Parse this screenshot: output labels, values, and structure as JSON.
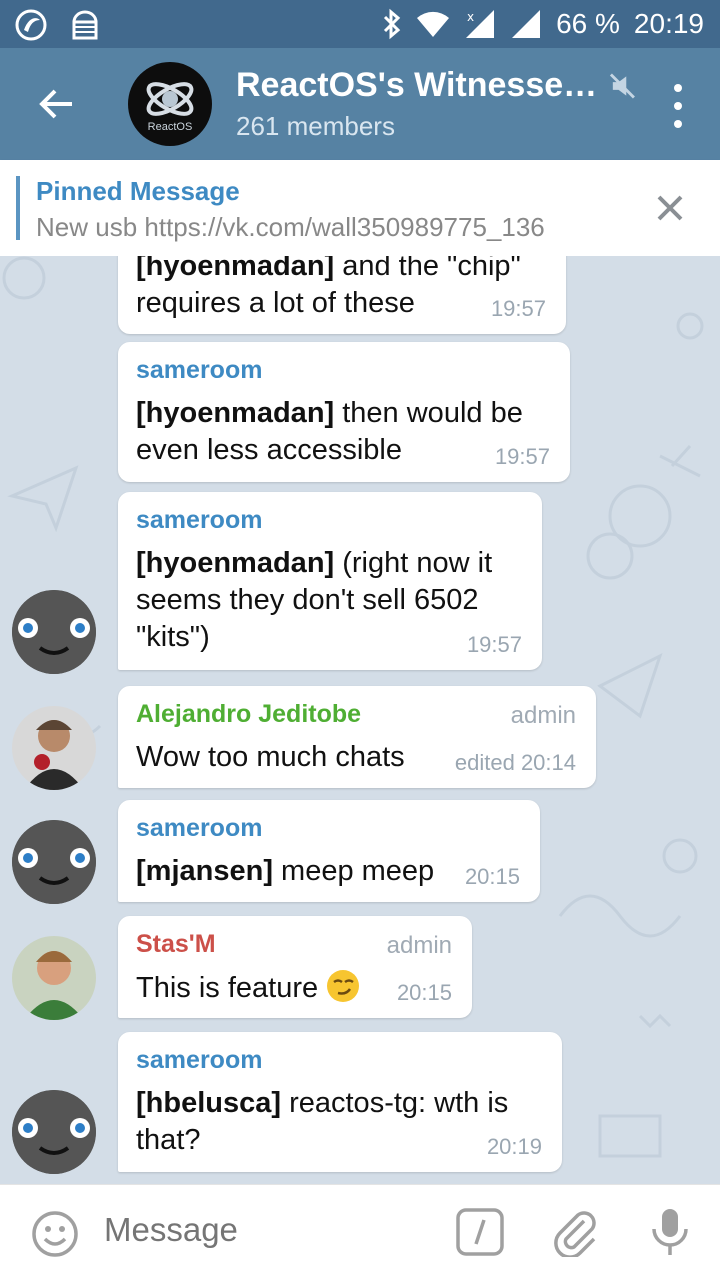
{
  "status_bar": {
    "battery": "66 %",
    "time": "20:19"
  },
  "header": {
    "title": "ReactOS's Witnesse…",
    "subtitle": "261 members",
    "avatar_logo_text": "ReactOS"
  },
  "pinned": {
    "title": "Pinned Message",
    "text": "New usb https://vk.com/wall350989775_136"
  },
  "messages": [
    {
      "sender": "",
      "bold": "[hyoenmadan]",
      "text": " and the \"chip\" requires a lot of these",
      "time": "19:57"
    },
    {
      "sender": "sameroom",
      "bold": "[hyoenmadan]",
      "text": " then would be even less accessible",
      "time": "19:57"
    },
    {
      "sender": "sameroom",
      "bold": "[hyoenmadan]",
      "text": " (right now it seems they don't sell 6502 \"kits\")",
      "time": "19:57"
    },
    {
      "sender": "Alejandro Jeditobe",
      "role": "admin",
      "text": "Wow too much chats",
      "time": "edited 20:14"
    },
    {
      "sender": "sameroom",
      "bold": "[mjansen]",
      "text": " meep meep",
      "time": "20:15"
    },
    {
      "sender": "Stas'M",
      "role": "admin",
      "text": "This is feature ",
      "time": "20:15"
    },
    {
      "sender": "sameroom",
      "bold": "[hbelusca]",
      "text": " reactos-tg: wth is that?",
      "time": "20:19"
    }
  ],
  "input": {
    "placeholder": "Message"
  },
  "colors": {
    "status_bar": "#41698d",
    "app_bar": "#5682a3",
    "sender_blue": "#3e8ac3",
    "sender_green": "#4fae33",
    "sender_red": "#cc5049"
  }
}
